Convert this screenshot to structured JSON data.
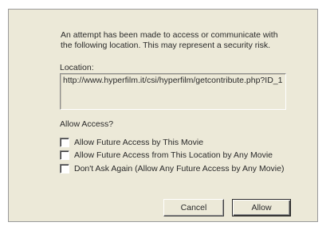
{
  "message": {
    "line1": "An attempt has been made to access or communicate with",
    "line2": "the following location. This may represent a security risk."
  },
  "location": {
    "label": "Location:",
    "value": "http://www.hyperfilm.it/csi/hyperfilm/getcontribute.php?ID_1"
  },
  "allow_access": {
    "label": "Allow Access?",
    "options": [
      {
        "label": "Allow Future Access by This Movie",
        "checked": false
      },
      {
        "label": "Allow Future Access from This Location by Any Movie",
        "checked": false
      },
      {
        "label": "Don't Ask Again (Allow Any Future Access by Any Movie)",
        "checked": false
      }
    ]
  },
  "buttons": {
    "cancel": "Cancel",
    "allow": "Allow"
  }
}
